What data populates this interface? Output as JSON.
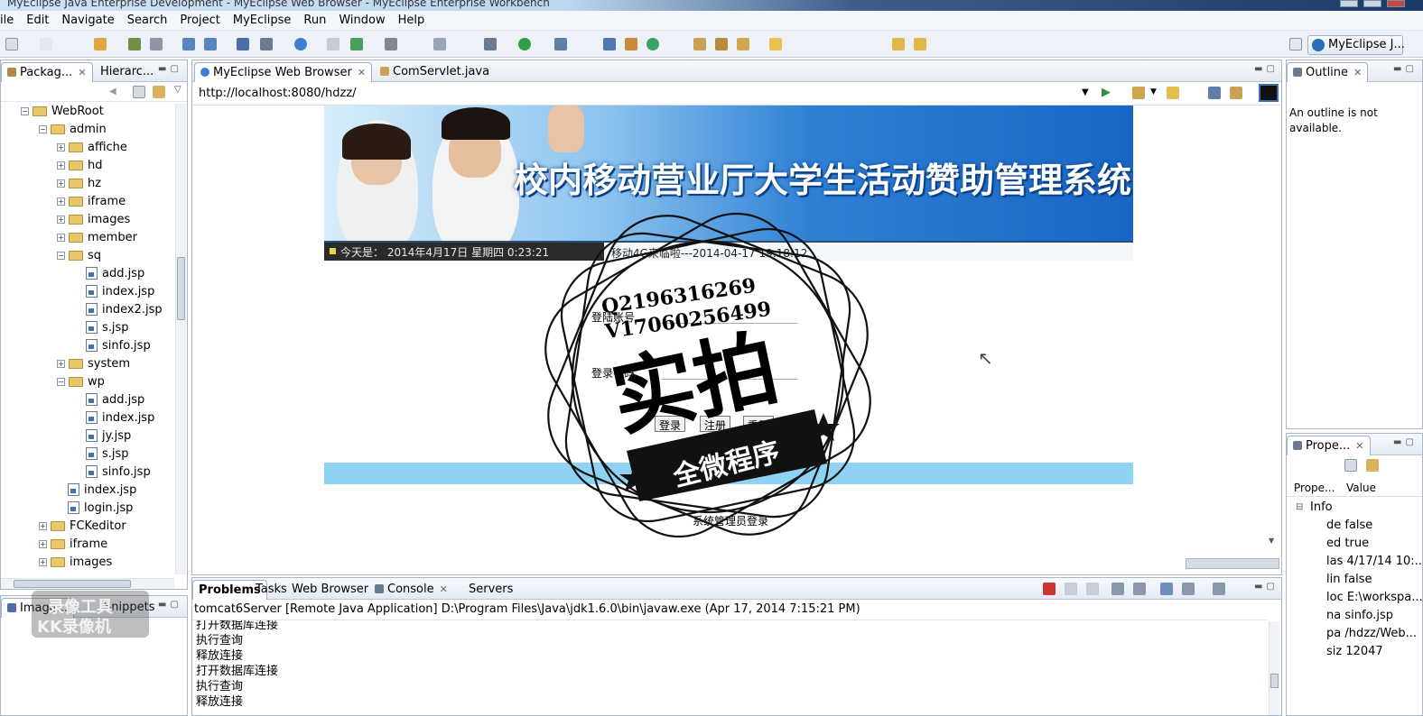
{
  "window": {
    "title": "MyEclipse Java Enterprise Development - MyEclipse Web Browser - MyEclipse Enterprise Workbench"
  },
  "menu": [
    "ile",
    "Edit",
    "Navigate",
    "Search",
    "Project",
    "MyEclipse",
    "Run",
    "Window",
    "Help"
  ],
  "perspective": {
    "label": "MyEclipse J..."
  },
  "left_panel": {
    "tabs": [
      "Packag...",
      "Hierarc..."
    ],
    "tree": [
      {
        "label": "WebRoot",
        "kind": "folder",
        "level": 1,
        "expanded": true
      },
      {
        "label": "admin",
        "kind": "folder",
        "level": 2,
        "expanded": true
      },
      {
        "label": "affiche",
        "kind": "folder",
        "level": 3,
        "expanded": false
      },
      {
        "label": "hd",
        "kind": "folder",
        "level": 3,
        "expanded": false
      },
      {
        "label": "hz",
        "kind": "folder",
        "level": 3,
        "expanded": false
      },
      {
        "label": "iframe",
        "kind": "folder",
        "level": 3,
        "expanded": false
      },
      {
        "label": "images",
        "kind": "folder",
        "level": 3,
        "expanded": false
      },
      {
        "label": "member",
        "kind": "folder",
        "level": 3,
        "expanded": false
      },
      {
        "label": "sq",
        "kind": "folder",
        "level": 3,
        "expanded": true
      },
      {
        "label": "add.jsp",
        "kind": "file",
        "level": 4
      },
      {
        "label": "index.jsp",
        "kind": "file",
        "level": 4
      },
      {
        "label": "index2.jsp",
        "kind": "file",
        "level": 4
      },
      {
        "label": "s.jsp",
        "kind": "file",
        "level": 4
      },
      {
        "label": "sinfo.jsp",
        "kind": "file",
        "level": 4
      },
      {
        "label": "system",
        "kind": "folder",
        "level": 3,
        "expanded": false
      },
      {
        "label": "wp",
        "kind": "folder",
        "level": 3,
        "expanded": true
      },
      {
        "label": "add.jsp",
        "kind": "file",
        "level": 4
      },
      {
        "label": "index.jsp",
        "kind": "file",
        "level": 4
      },
      {
        "label": "jy.jsp",
        "kind": "file",
        "level": 4
      },
      {
        "label": "s.jsp",
        "kind": "file",
        "level": 4
      },
      {
        "label": "sinfo.jsp",
        "kind": "file",
        "level": 4
      },
      {
        "label": "index.jsp",
        "kind": "file",
        "level": 3
      },
      {
        "label": "login.jsp",
        "kind": "file",
        "level": 3
      },
      {
        "label": "FCKeditor",
        "kind": "folder",
        "level": 2,
        "expanded": false
      },
      {
        "label": "iframe",
        "kind": "folder",
        "level": 2,
        "expanded": false
      },
      {
        "label": "images",
        "kind": "folder",
        "level": 2,
        "expanded": false
      }
    ]
  },
  "image_panel": {
    "tabs": [
      "Image...",
      "Snippets"
    ]
  },
  "editor": {
    "tabs": [
      "MyEclipse Web Browser",
      "ComServlet.java"
    ],
    "url": "http://localhost:8080/hdzz/"
  },
  "webpage": {
    "banner_title": "校内移动营业厅大学生活动赞助管理系统",
    "date_text": "今天是：  2014年4月17日 星期四 0:23:21",
    "marquee": "移动4G来临啦---2014-04-17 19:18:12",
    "label_username": "登陆账号",
    "label_password": "登录密码",
    "buttons": [
      "登录",
      "注册",
      "重置"
    ],
    "footer": "系统管理员登录"
  },
  "watermark": {
    "qq": "Q2196316269",
    "wechat": "V17060256499",
    "big": "实拍",
    "ribbon": "全微程序"
  },
  "outline": {
    "title": "Outline",
    "message": "An outline is not available."
  },
  "properties": {
    "title": "Prope...",
    "columns": [
      "Prope...",
      "Value"
    ],
    "category": "Info",
    "rows": [
      "de false",
      "ed true",
      "las 4/17/14 10:...",
      "lin false",
      "loc E:\\workspa...",
      "na sinfo.jsp",
      "pa /hdzz/Web...",
      "siz 12047"
    ]
  },
  "bottom": {
    "tabs": [
      "Problems",
      "Tasks",
      "Web Browser",
      "Console",
      "Servers"
    ],
    "server_line": "tomcat6Server [Remote Java Application] D:\\Program Files\\Java\\jdk1.6.0\\bin\\javaw.exe (Apr 17, 2014 7:15:21 PM)",
    "console_lines": [
      "打开数据库连接",
      "执行查询",
      "释放连接",
      "打开数据库连接",
      "执行查询",
      "释放连接"
    ]
  },
  "logo_watermark": {
    "line1": "录像工具",
    "line2": "KK录像机"
  }
}
